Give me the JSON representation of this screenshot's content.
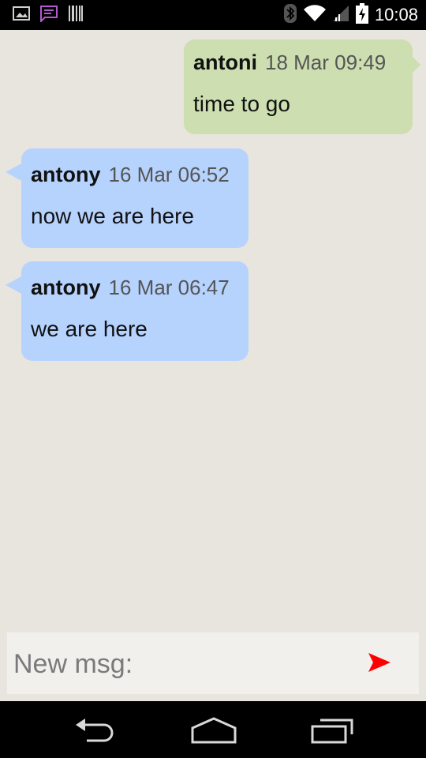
{
  "status_bar": {
    "time": "10:08",
    "icons": [
      "image-icon",
      "message-icon",
      "barcode-icon",
      "bluetooth-icon",
      "wifi-icon",
      "signal-icon",
      "battery-charging-icon"
    ]
  },
  "messages": [
    {
      "direction": "outgoing",
      "sender": "antoni",
      "time": "18 Mar 09:49",
      "text": "time to go"
    },
    {
      "direction": "incoming",
      "sender": "antony",
      "time": "16 Mar 06:52",
      "text": "now we are here"
    },
    {
      "direction": "incoming",
      "sender": "antony",
      "time": "16 Mar 06:47",
      "text": "we are here"
    }
  ],
  "composer": {
    "placeholder": "New msg:",
    "value": "",
    "send_icon": "send-icon",
    "send_color": "#ff0000"
  },
  "navigation": {
    "buttons": [
      "back-icon",
      "home-icon",
      "recent-apps-icon"
    ]
  },
  "colors": {
    "background": "#e8e4de",
    "outgoing_bubble": "#cddeb0",
    "incoming_bubble": "#b6d3fe"
  }
}
